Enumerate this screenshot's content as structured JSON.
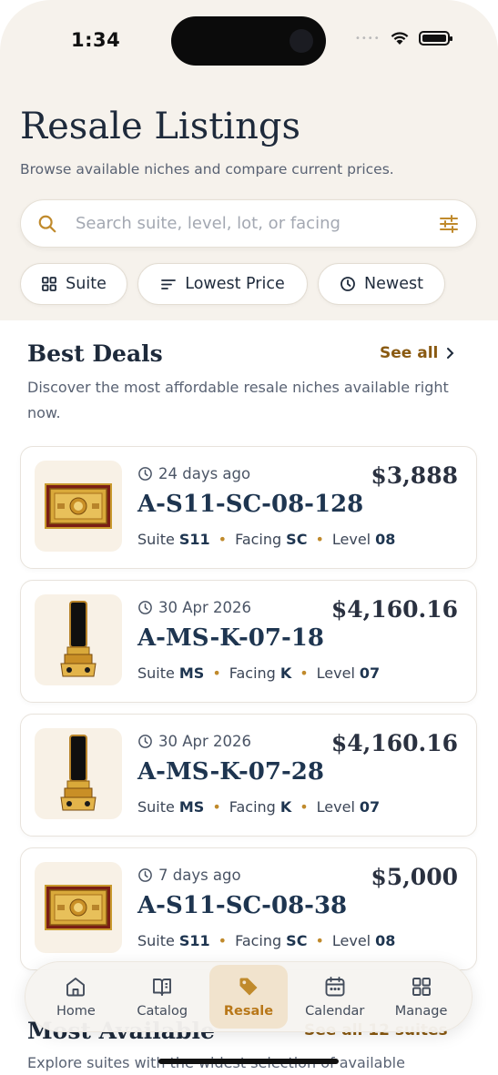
{
  "status_bar": {
    "time": "1:34"
  },
  "header": {
    "title": "Resale Listings",
    "subtitle": "Browse available niches and compare current prices."
  },
  "search": {
    "placeholder": "Search suite, level, lot, or facing",
    "value": ""
  },
  "filters": [
    {
      "label": "Suite",
      "icon": "grid-icon"
    },
    {
      "label": "Lowest Price",
      "icon": "sort-lines-icon"
    },
    {
      "label": "Newest",
      "icon": "clock-icon"
    }
  ],
  "best_deals": {
    "title": "Best Deals",
    "see_all": "See all",
    "description": "Discover the most affordable resale niches available right now.",
    "items": [
      {
        "time": "24 days ago",
        "code": "A-S11-SC-08-128",
        "price": "$3,888",
        "suite": "S11",
        "facing": "SC",
        "level": "08",
        "thumb": "plaque-niche-image"
      },
      {
        "time": "30 Apr 2026",
        "code": "A-MS-K-07-18",
        "price": "$4,160.16",
        "suite": "MS",
        "facing": "K",
        "level": "07",
        "thumb": "tablet-niche-image"
      },
      {
        "time": "30 Apr 2026",
        "code": "A-MS-K-07-28",
        "price": "$4,160.16",
        "suite": "MS",
        "facing": "K",
        "level": "07",
        "thumb": "tablet-niche-image"
      },
      {
        "time": "7 days ago",
        "code": "A-S11-SC-08-38",
        "price": "$5,000",
        "suite": "S11",
        "facing": "SC",
        "level": "08",
        "thumb": "plaque-niche-image"
      }
    ],
    "labels": {
      "suite": "Suite",
      "facing": "Facing",
      "level": "Level"
    }
  },
  "most_available": {
    "title": "Most Available",
    "see_all": "See all 12 suites",
    "description": "Explore suites with the widest selection of available"
  },
  "tabbar": {
    "items": [
      {
        "label": "Home",
        "icon": "home-icon"
      },
      {
        "label": "Catalog",
        "icon": "book-icon"
      },
      {
        "label": "Resale",
        "icon": "tag-icon",
        "active": true
      },
      {
        "label": "Calendar",
        "icon": "calendar-icon"
      },
      {
        "label": "Manage",
        "icon": "grid-icon"
      }
    ]
  },
  "colors": {
    "accent": "#b87718",
    "header_bg": "#f6f2ec",
    "heading": "#1e2a3b",
    "active_tab_bg": "#f1e3cd"
  }
}
